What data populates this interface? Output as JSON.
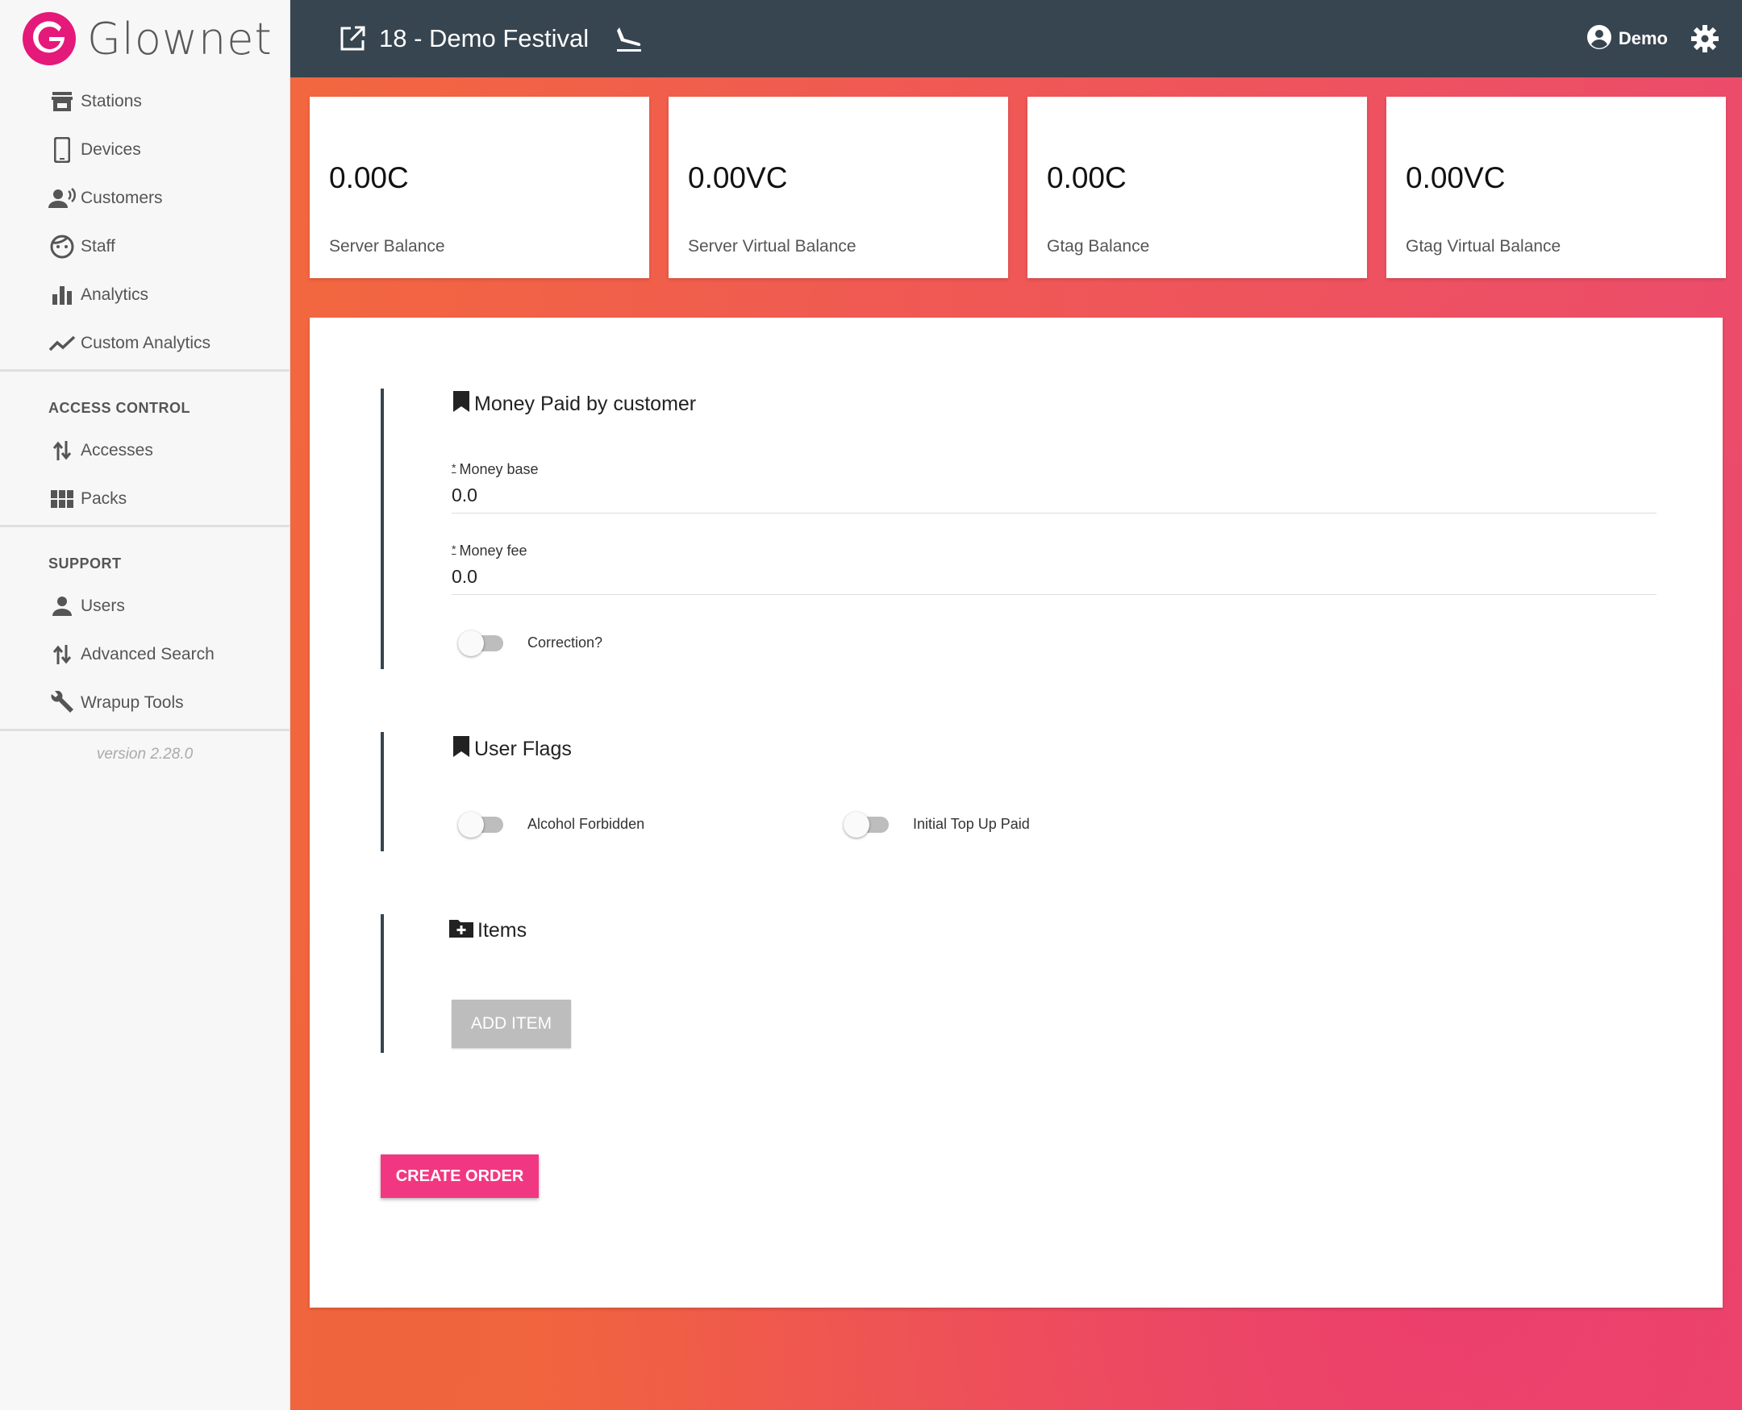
{
  "brand": {
    "name": "Glownet",
    "logo_letter": "G",
    "color": "#e5197a"
  },
  "sidebar": {
    "main_items": [
      {
        "label": "Stations",
        "icon": "store-icon"
      },
      {
        "label": "Devices",
        "icon": "phone-icon"
      },
      {
        "label": "Customers",
        "icon": "speaking-person-icon"
      },
      {
        "label": "Staff",
        "icon": "face-icon"
      },
      {
        "label": "Analytics",
        "icon": "bar-chart-icon"
      },
      {
        "label": "Custom Analytics",
        "icon": "line-chart-icon"
      }
    ],
    "access_control": {
      "heading": "ACCESS CONTROL",
      "items": [
        {
          "label": "Accesses",
          "icon": "swap-vertical-icon"
        },
        {
          "label": "Packs",
          "icon": "grid-icon"
        }
      ]
    },
    "support": {
      "heading": "SUPPORT",
      "items": [
        {
          "label": "Users",
          "icon": "person-icon"
        },
        {
          "label": "Advanced Search",
          "icon": "swap-vertical-icon"
        },
        {
          "label": "Wrapup Tools",
          "icon": "wrench-icon"
        }
      ]
    },
    "version": "version 2.28.0"
  },
  "topbar": {
    "event_title": "18 - Demo Festival",
    "user_name": "Demo",
    "bg_color": "#374550"
  },
  "cards": [
    {
      "value": "0.00C",
      "label": "Server Balance"
    },
    {
      "value": "0.00VC",
      "label": "Server Virtual Balance"
    },
    {
      "value": "0.00C",
      "label": "Gtag Balance"
    },
    {
      "value": "0.00VC",
      "label": "Gtag Virtual Balance"
    }
  ],
  "form": {
    "money_section": {
      "title": "Money Paid by customer",
      "money_base": {
        "required_mark": "*",
        "label": "Money base",
        "value": "0.0"
      },
      "money_fee": {
        "required_mark": "*",
        "label": "Money fee",
        "value": "0.0"
      },
      "correction": {
        "label": "Correction?",
        "checked": false
      }
    },
    "flags_section": {
      "title": "User Flags",
      "alcohol_forbidden": {
        "label": "Alcohol Forbidden",
        "checked": false
      },
      "initial_top_up_paid": {
        "label": "Initial Top Up Paid",
        "checked": false
      }
    },
    "items_section": {
      "title": "Items",
      "add_item_label": "ADD ITEM"
    },
    "create_order_label": "CREATE ORDER",
    "accent_color": "#f23782"
  }
}
